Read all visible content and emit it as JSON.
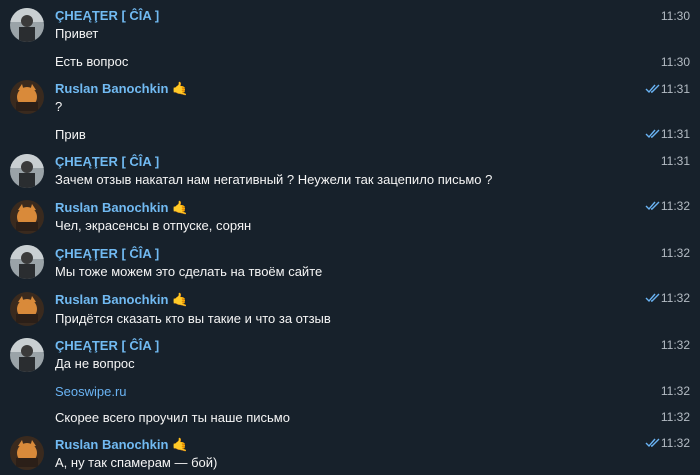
{
  "colors": {
    "background": "#17212b",
    "name": "#71baf2",
    "text": "#f5f5f5",
    "time": "#b4bcc4",
    "check": "#6ab3f3"
  },
  "users": {
    "cheater": "ÇHEĄŢER [ ĈÎA ]",
    "ruslan": "Ruslan Banochkin",
    "ruslan_emoji": "🤙"
  },
  "messages": [
    {
      "text": "Привет",
      "time": "11:30"
    },
    {
      "text": "Есть вопрос",
      "time": "11:30"
    },
    {
      "text": "?",
      "time": "11:31"
    },
    {
      "text": "Прив",
      "time": "11:31"
    },
    {
      "text": "Зачем отзыв накатал нам негативный ? Неужели так зацепило письмо ?",
      "time": "11:31"
    },
    {
      "text": "Чел, экрасенсы в отпуске, сорян",
      "time": "11:32"
    },
    {
      "text": "Мы тоже можем это сделать на твоём сайте",
      "time": "11:32"
    },
    {
      "text": "Придётся сказать кто вы такие и что за отзыв",
      "time": "11:32"
    },
    {
      "text": "Да не вопрос",
      "time": "11:32"
    },
    {
      "text": "Seoswipe.ru",
      "time": "11:32"
    },
    {
      "text": "Скорее всего проучил ты наше письмо",
      "time": "11:32"
    },
    {
      "text": "А, ну так спамерам — бой)",
      "time": "11:32"
    }
  ]
}
